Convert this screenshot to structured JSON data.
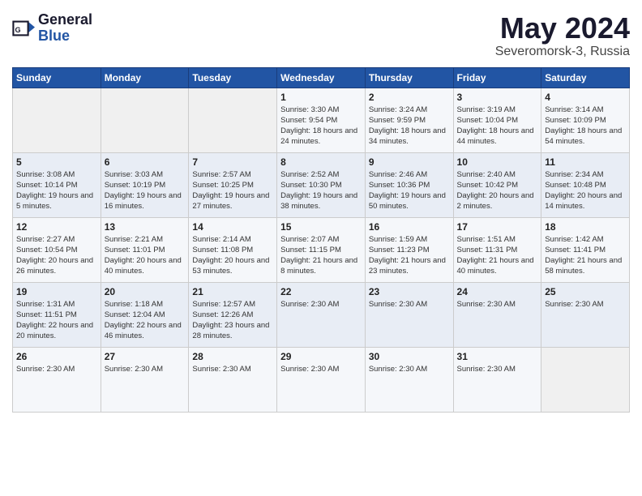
{
  "logo": {
    "text_general": "General",
    "text_blue": "Blue"
  },
  "title": "May 2024",
  "location": "Severomorsk-3, Russia",
  "weekdays": [
    "Sunday",
    "Monday",
    "Tuesday",
    "Wednesday",
    "Thursday",
    "Friday",
    "Saturday"
  ],
  "weeks": [
    [
      {
        "day": "",
        "info": ""
      },
      {
        "day": "",
        "info": ""
      },
      {
        "day": "",
        "info": ""
      },
      {
        "day": "1",
        "info": "Sunrise: 3:30 AM\nSunset: 9:54 PM\nDaylight: 18 hours\nand 24 minutes."
      },
      {
        "day": "2",
        "info": "Sunrise: 3:24 AM\nSunset: 9:59 PM\nDaylight: 18 hours\nand 34 minutes."
      },
      {
        "day": "3",
        "info": "Sunrise: 3:19 AM\nSunset: 10:04 PM\nDaylight: 18 hours\nand 44 minutes."
      },
      {
        "day": "4",
        "info": "Sunrise: 3:14 AM\nSunset: 10:09 PM\nDaylight: 18 hours\nand 54 minutes."
      }
    ],
    [
      {
        "day": "5",
        "info": "Sunrise: 3:08 AM\nSunset: 10:14 PM\nDaylight: 19 hours\nand 5 minutes."
      },
      {
        "day": "6",
        "info": "Sunrise: 3:03 AM\nSunset: 10:19 PM\nDaylight: 19 hours\nand 16 minutes."
      },
      {
        "day": "7",
        "info": "Sunrise: 2:57 AM\nSunset: 10:25 PM\nDaylight: 19 hours\nand 27 minutes."
      },
      {
        "day": "8",
        "info": "Sunrise: 2:52 AM\nSunset: 10:30 PM\nDaylight: 19 hours\nand 38 minutes."
      },
      {
        "day": "9",
        "info": "Sunrise: 2:46 AM\nSunset: 10:36 PM\nDaylight: 19 hours\nand 50 minutes."
      },
      {
        "day": "10",
        "info": "Sunrise: 2:40 AM\nSunset: 10:42 PM\nDaylight: 20 hours\nand 2 minutes."
      },
      {
        "day": "11",
        "info": "Sunrise: 2:34 AM\nSunset: 10:48 PM\nDaylight: 20 hours\nand 14 minutes."
      }
    ],
    [
      {
        "day": "12",
        "info": "Sunrise: 2:27 AM\nSunset: 10:54 PM\nDaylight: 20 hours\nand 26 minutes."
      },
      {
        "day": "13",
        "info": "Sunrise: 2:21 AM\nSunset: 11:01 PM\nDaylight: 20 hours\nand 40 minutes."
      },
      {
        "day": "14",
        "info": "Sunrise: 2:14 AM\nSunset: 11:08 PM\nDaylight: 20 hours\nand 53 minutes."
      },
      {
        "day": "15",
        "info": "Sunrise: 2:07 AM\nSunset: 11:15 PM\nDaylight: 21 hours\nand 8 minutes."
      },
      {
        "day": "16",
        "info": "Sunrise: 1:59 AM\nSunset: 11:23 PM\nDaylight: 21 hours\nand 23 minutes."
      },
      {
        "day": "17",
        "info": "Sunrise: 1:51 AM\nSunset: 11:31 PM\nDaylight: 21 hours\nand 40 minutes."
      },
      {
        "day": "18",
        "info": "Sunrise: 1:42 AM\nSunset: 11:41 PM\nDaylight: 21 hours\nand 58 minutes."
      }
    ],
    [
      {
        "day": "19",
        "info": "Sunrise: 1:31 AM\nSunset: 11:51 PM\nDaylight: 22 hours\nand 20 minutes."
      },
      {
        "day": "20",
        "info": "Sunrise: 1:18 AM\nSunset: 12:04 AM\nDaylight: 22 hours\nand 46 minutes."
      },
      {
        "day": "21",
        "info": "Sunrise: 12:57 AM\nSunset: 12:26 AM\nDaylight: 23 hours\nand 28 minutes."
      },
      {
        "day": "22",
        "info": "Sunrise: 2:30 AM"
      },
      {
        "day": "23",
        "info": "Sunrise: 2:30 AM"
      },
      {
        "day": "24",
        "info": "Sunrise: 2:30 AM"
      },
      {
        "day": "25",
        "info": "Sunrise: 2:30 AM"
      }
    ],
    [
      {
        "day": "26",
        "info": "Sunrise: 2:30 AM"
      },
      {
        "day": "27",
        "info": "Sunrise: 2:30 AM"
      },
      {
        "day": "28",
        "info": "Sunrise: 2:30 AM"
      },
      {
        "day": "29",
        "info": "Sunrise: 2:30 AM"
      },
      {
        "day": "30",
        "info": "Sunrise: 2:30 AM"
      },
      {
        "day": "31",
        "info": "Sunrise: 2:30 AM"
      },
      {
        "day": "",
        "info": ""
      }
    ]
  ]
}
